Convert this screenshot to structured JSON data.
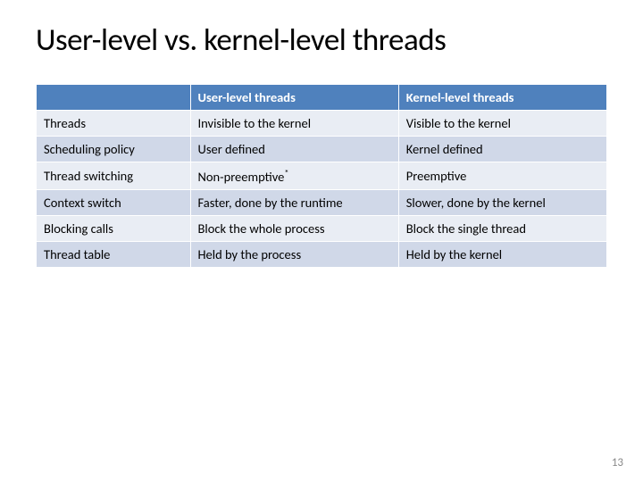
{
  "title": "User-level vs. kernel-level threads",
  "headers": {
    "blank": "",
    "col1": "User-level threads",
    "col2": "Kernel-level threads"
  },
  "rows": [
    {
      "label": "Threads",
      "user": "Invisible to the kernel",
      "kernel": "Visible to the kernel"
    },
    {
      "label": "Scheduling policy",
      "user": "User defined",
      "kernel": "Kernel defined"
    },
    {
      "label": "Thread switching",
      "user": "Non-preemptive*",
      "kernel": "Preemptive"
    },
    {
      "label": "Context switch",
      "user": "Faster, done by the runtime",
      "kernel": "Slower, done by the kernel"
    },
    {
      "label": "Blocking calls",
      "user": "Block the whole process",
      "kernel": "Block the single thread"
    },
    {
      "label": "Thread table",
      "user": "Held by the process",
      "kernel": "Held by the kernel"
    }
  ],
  "page_number": "13",
  "chart_data": {
    "type": "table",
    "title": "User-level vs. kernel-level threads",
    "columns": [
      "",
      "User-level threads",
      "Kernel-level threads"
    ],
    "rows": [
      [
        "Threads",
        "Invisible to the kernel",
        "Visible to the kernel"
      ],
      [
        "Scheduling policy",
        "User defined",
        "Kernel defined"
      ],
      [
        "Thread switching",
        "Non-preemptive*",
        "Preemptive"
      ],
      [
        "Context switch",
        "Faster, done by the runtime",
        "Slower, done by the kernel"
      ],
      [
        "Blocking calls",
        "Block the whole process",
        "Block the single thread"
      ],
      [
        "Thread table",
        "Held by the process",
        "Held by the kernel"
      ]
    ]
  }
}
